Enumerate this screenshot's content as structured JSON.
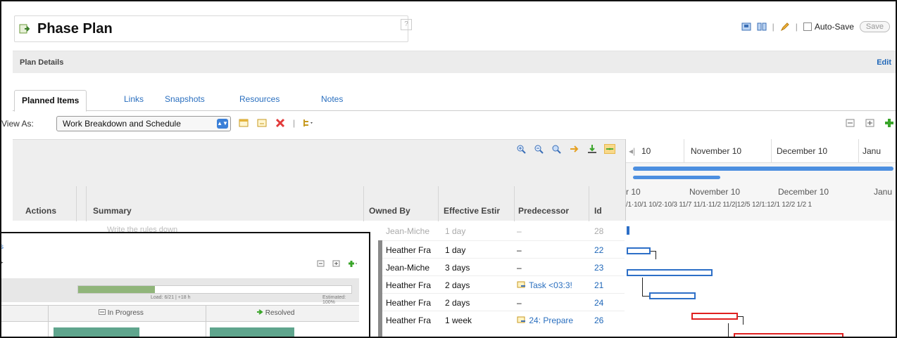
{
  "header": {
    "title": "Phase Plan",
    "help": "?",
    "auto_save_label": "Auto-Save",
    "save_label": "Save"
  },
  "details": {
    "label": "Plan Details",
    "edit_label": "Edit"
  },
  "tabs": [
    {
      "label": "Planned Items",
      "active": true
    },
    {
      "label": "Links"
    },
    {
      "label": "Snapshots"
    },
    {
      "label": "Resources"
    },
    {
      "label": "Notes"
    }
  ],
  "view_as": {
    "label": "View As:",
    "selected": "Work Breakdown and Schedule"
  },
  "columns": {
    "actions": "Actions",
    "summary": "Summary",
    "owned_by": "Owned By",
    "effective_estimate": "Effective Estir",
    "predecessor": "Predecessor",
    "id": "Id"
  },
  "gantt": {
    "scroll_labels": [
      "10",
      "November 10",
      "December 10",
      "Janu"
    ],
    "months": [
      "r 10",
      "November 10",
      "December 10",
      "Janu"
    ],
    "weeks": "/1·10/1 10/2·10/3 11/7 11/1·11/2 11/2|12/5 12/1:12/1 12/2  1/2   1"
  },
  "rows": [
    {
      "summary": "Write the rules down",
      "owner": "Jean-Miche",
      "estimate": "1 day",
      "predecessor": "–",
      "id": "28",
      "faded": true
    },
    {
      "owner": "Heather Fra",
      "estimate": "1 day",
      "predecessor": "–",
      "id": "22"
    },
    {
      "owner": "Jean-Miche",
      "estimate": "3 days",
      "predecessor": "–",
      "id": "23"
    },
    {
      "owner": "Heather Fra",
      "estimate": "2 days",
      "predecessor": "Task <03:3!",
      "id": "21"
    },
    {
      "owner": "Heather Fra",
      "estimate": "2 days",
      "predecessor": "–",
      "id": "24"
    },
    {
      "owner": "Heather Fra",
      "estimate": "1 week",
      "predecessor": "24: Prepare",
      "id": "26"
    }
  ],
  "overlay": {
    "link": "s",
    "progress_fraction": 0.28,
    "load_text": "Load: 6/21 | +18 h",
    "estimated_text": "Estimated: 100%",
    "col_in_progress": "In Progress",
    "col_resolved": "Resolved"
  }
}
